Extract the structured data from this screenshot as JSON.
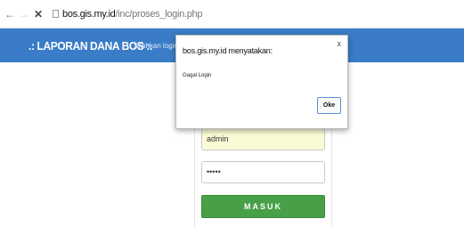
{
  "browser": {
    "url_host": "bos.gis.my.id",
    "url_path": "/inc/proses_login.php"
  },
  "header": {
    "title": ".: LAPORAN DANA BOS :.",
    "subtitle": "Silahkan login te"
  },
  "login": {
    "username_value": "admin",
    "password_value": "•••••",
    "submit_label": "MASUK"
  },
  "dialog": {
    "title": "bos.gis.my.id menyatakan:",
    "close_label": "x",
    "message": "Gagal Login",
    "ok_label": "Oke"
  },
  "colors": {
    "header_bg": "#3a7cc8",
    "submit_bg": "#47a047",
    "username_bg": "#fbfbd5"
  },
  "icons": {
    "back": "arrow-left-icon",
    "forward": "arrow-right-icon",
    "stop": "close-icon",
    "page": "page-icon"
  }
}
